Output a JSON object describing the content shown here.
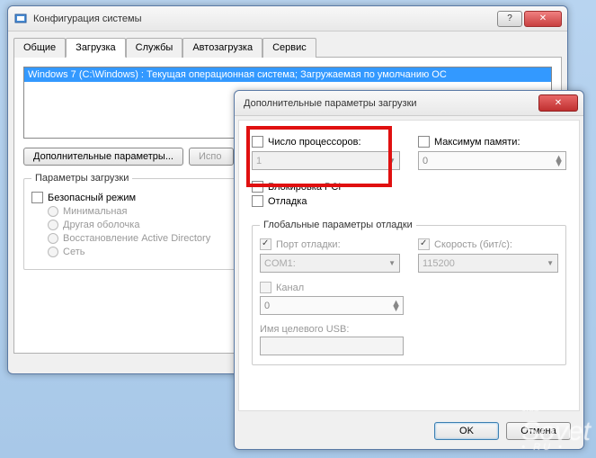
{
  "main_window": {
    "title": "Конфигурация системы",
    "tabs": [
      "Общие",
      "Загрузка",
      "Службы",
      "Автозагрузка",
      "Сервис"
    ],
    "active_tab": 1,
    "boot_entry": "Windows 7 (C:\\Windows) : Текущая операционная система; Загружаемая по умолчанию ОС",
    "btn_advanced": "Дополнительные параметры...",
    "btn_use_partial": "Испо",
    "group_boot_params": "Параметры загрузки",
    "chk_safe_mode": "Безопасный режим",
    "radio_minimal": "Минимальная",
    "radio_altshell": "Другая оболочка",
    "radio_adrepair": "Восстановление Active Directory",
    "radio_network": "Сеть"
  },
  "dialog": {
    "title": "Дополнительные параметры загрузки",
    "chk_numproc": "Число процессоров:",
    "numproc_value": "1",
    "chk_maxmem": "Максимум памяти:",
    "maxmem_value": "0",
    "chk_pcilock": "Блокировка PCI",
    "chk_debug": "Отладка",
    "group_debug": "Глобальные параметры отладки",
    "chk_debugport": "Порт отладки:",
    "debugport_value": "COM1:",
    "chk_baudrate": "Скорость (бит/с):",
    "baudrate_value": "115200",
    "chk_channel": "Канал",
    "channel_value": "0",
    "lbl_usb": "Имя целевого USB:",
    "usb_value": "",
    "btn_ok": "OK",
    "btn_cancel": "Отмена"
  },
  "watermark": {
    "line1": "club",
    "line2": "Sovet",
    "line3": "• RU •"
  }
}
